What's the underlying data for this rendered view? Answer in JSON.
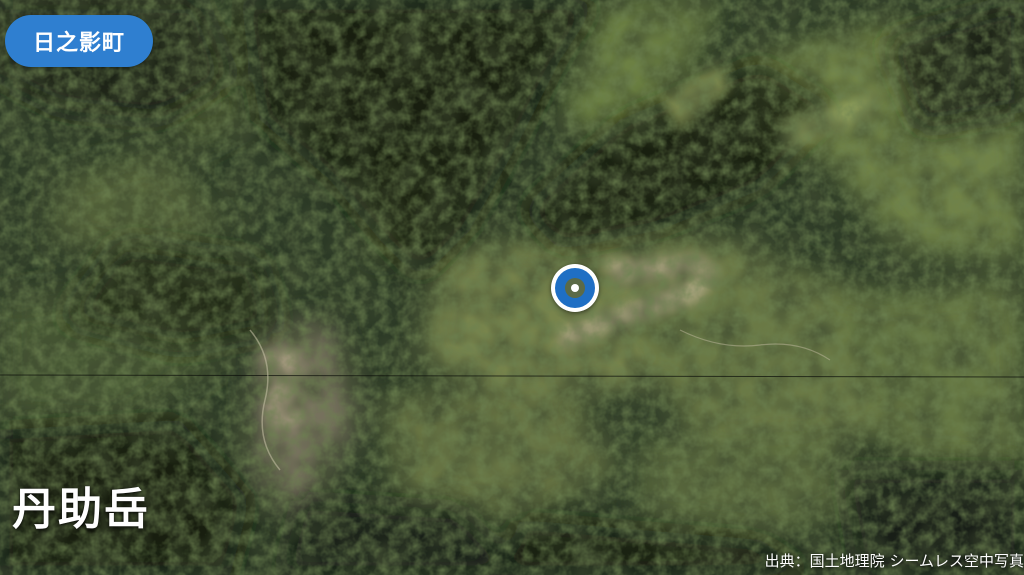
{
  "region_badge": {
    "label": "日之影町",
    "color": "#2f7fd0"
  },
  "map": {
    "type": "aerial-photo",
    "marker_icon": "location-pin-icon",
    "marker_color": "#1f6fc4"
  },
  "place": {
    "name": "丹助岳"
  },
  "attribution": {
    "text": "出典：国土地理院 シームレス空中写真"
  }
}
